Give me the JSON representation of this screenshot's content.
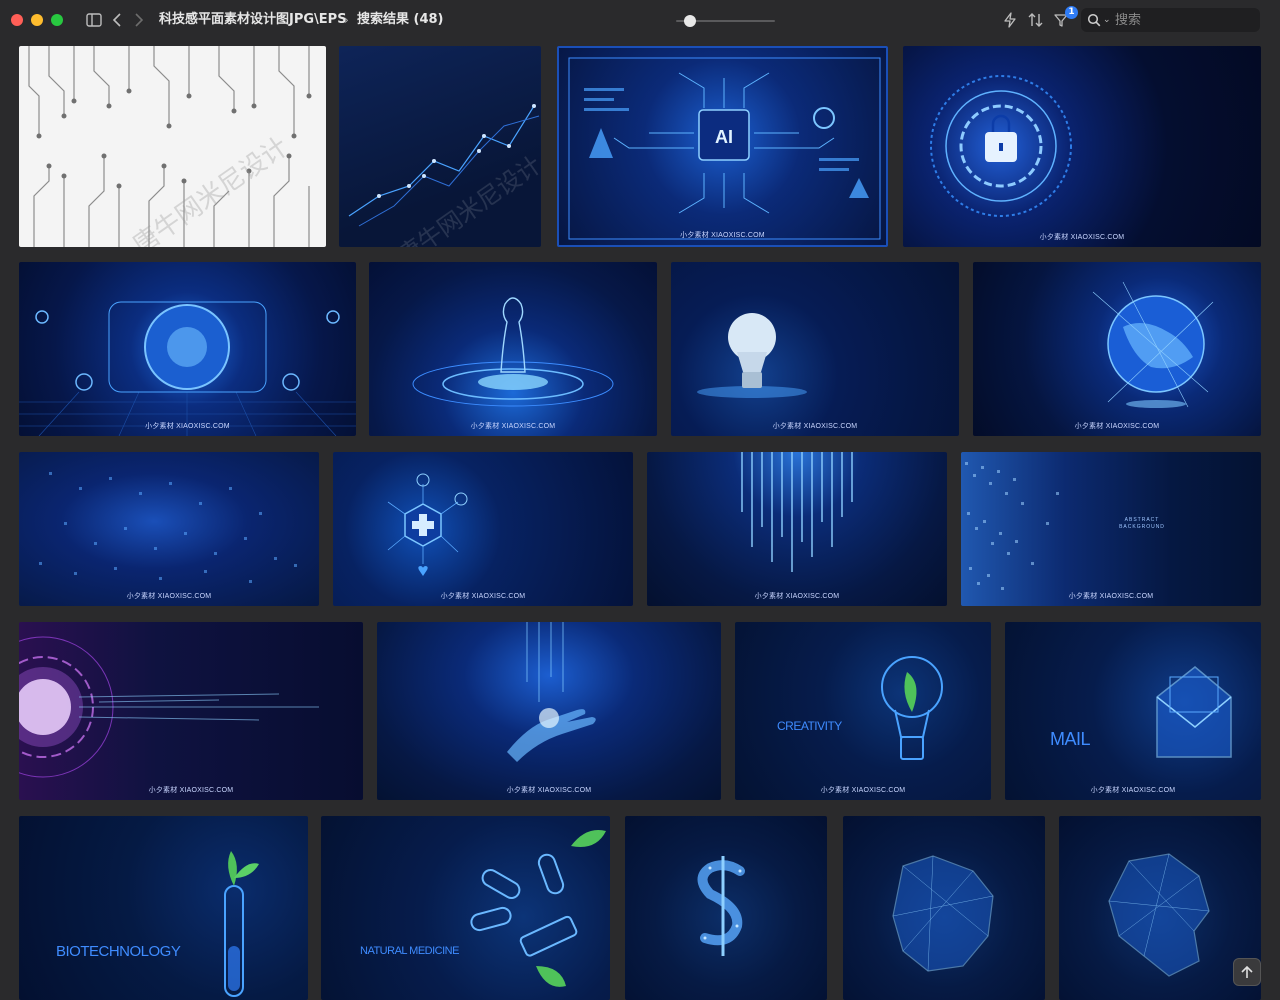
{
  "window": {
    "breadcrumb_path": "科技感平面素材设计图JPG\\EPS",
    "breadcrumb_separator": "›",
    "search_result_label": "搜索结果 (48)"
  },
  "toolbar": {
    "filter_badge": "1",
    "search_placeholder": "搜索",
    "zoom_level": 0.14
  },
  "watermark": "小夕素材 XIAOXISC.COM",
  "thumbnails": [
    {
      "id": 1,
      "theme": "white circuit lines",
      "overlay_text": "唐牛网米尼设计"
    },
    {
      "id": 2,
      "theme": "blue network graph",
      "overlay_text": "唐牛网米尼设计"
    },
    {
      "id": 3,
      "theme": "AI chip hud",
      "chip_label": "AI"
    },
    {
      "id": 4,
      "theme": "security lock circle"
    },
    {
      "id": 5,
      "theme": "hud circle grid"
    },
    {
      "id": 6,
      "theme": "holographic chess piece"
    },
    {
      "id": 7,
      "theme": "light bulb"
    },
    {
      "id": 8,
      "theme": "digital globe"
    },
    {
      "id": 9,
      "theme": "blue binary matrix"
    },
    {
      "id": 10,
      "theme": "medical hexagon cross"
    },
    {
      "id": 11,
      "theme": "falling digital rain"
    },
    {
      "id": 12,
      "theme": "abstract background",
      "caption_line1": "ABSTRACT",
      "caption_line2": "BACKGROUND"
    },
    {
      "id": 13,
      "theme": "purple radial burst"
    },
    {
      "id": 14,
      "theme": "digital hand"
    },
    {
      "id": 15,
      "theme": "creativity bulb",
      "caption": "CREATIVITY"
    },
    {
      "id": 16,
      "theme": "mail envelope",
      "caption": "MAIL"
    },
    {
      "id": 17,
      "theme": "biotechnology test tube",
      "caption": "BIOTECHNOLOGY"
    },
    {
      "id": 18,
      "theme": "natural medicine pills",
      "caption": "NATURAL MEDICINE"
    },
    {
      "id": 19,
      "theme": "dollar sign polygon"
    },
    {
      "id": 20,
      "theme": "map polygon A"
    },
    {
      "id": 21,
      "theme": "map polygon B"
    }
  ]
}
